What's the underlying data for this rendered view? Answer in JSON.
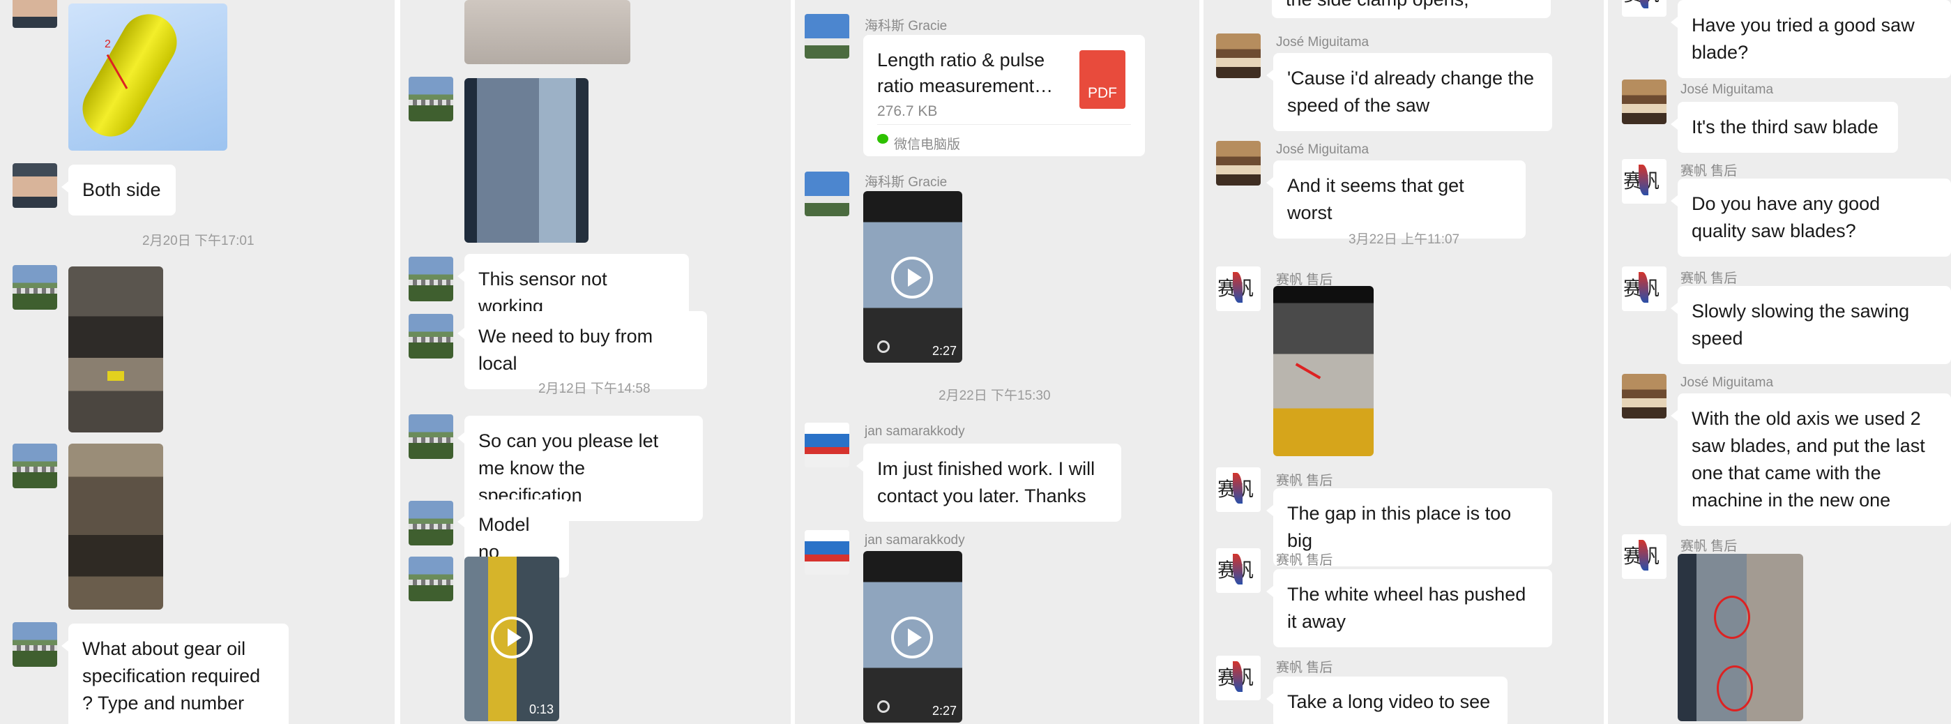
{
  "col1": {
    "msg_both_side": "Both side",
    "timestamp1": "2月20日 下午17:01",
    "msg_gear_oil": "What about gear oil specification required ? Type and number",
    "part_label": "2"
  },
  "col2": {
    "msg_sensor": "This sensor not working",
    "msg_buy_local": "We need to buy from local",
    "timestamp1": "2月12日 下午14:58",
    "msg_specification": "So can you please let me know the specification",
    "msg_model": "Model no",
    "video_duration": "0:13"
  },
  "col3": {
    "sender_gracie": "海科斯 Gracie",
    "file_name": "Length ratio & pulse ratio measurement…",
    "file_size": "276.7 KB",
    "file_source": "微信电脑版",
    "file_badge": "PDF",
    "video1_duration": "2:27",
    "timestamp1": "2月22日 下午15:30",
    "sender_jan": "jan samarakkody",
    "msg_finished": "Im just finished work. I will contact you later. Thanks",
    "video2_duration": "2:27"
  },
  "col4": {
    "msg_clamp": "the side clamp opens,",
    "sender_jose": "José Miguitama",
    "msg_changed_speed": "'Cause i'd already change the speed of the saw",
    "msg_worst": "And it seems that get worst",
    "timestamp1": "3月22日 上午11:07",
    "sender_saifan": "赛帆 售后",
    "msg_gap": "The gap in this place is too big",
    "msg_white_wheel": "The white wheel has pushed it away",
    "msg_long_video": "Take a long video to see"
  },
  "col5": {
    "msg_good_blade": "Have you tried a good saw blade?",
    "sender_jose": "José Miguitama",
    "msg_third_blade": "It's the third saw blade",
    "sender_saifan": "赛帆 售后",
    "msg_quality_blades": "Do you have any good quality saw blades?",
    "msg_slowing": "Slowly slowing the sawing speed",
    "msg_old_axis": "With the old axis we used 2 saw blades, and put the last one that came with the machine in the new one"
  },
  "avatar_glyph": "赛帆"
}
